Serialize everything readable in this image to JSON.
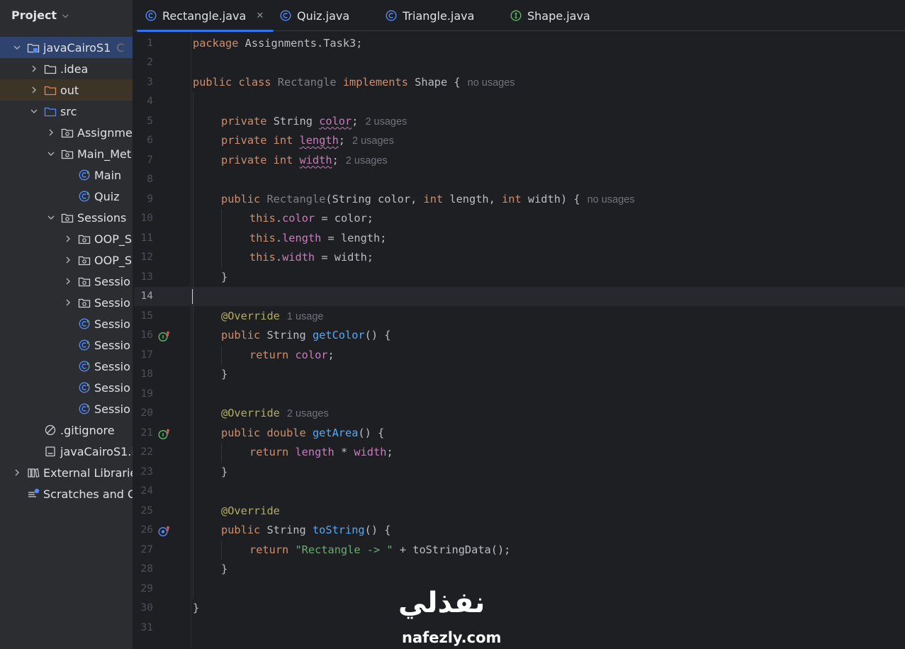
{
  "project_panel": {
    "title": "Project",
    "tree": [
      {
        "label": "javaCairoS1",
        "suffix": "C",
        "icon": "module-folder-icon",
        "depth": 0,
        "expanded": true,
        "selected": true
      },
      {
        "label": ".idea",
        "icon": "folder-icon",
        "depth": 1,
        "expanded": false
      },
      {
        "label": "out",
        "icon": "folder-excluded-icon",
        "depth": 1,
        "expanded": false,
        "excluded": true
      },
      {
        "label": "src",
        "icon": "source-folder-icon",
        "depth": 1,
        "expanded": true
      },
      {
        "label": "Assignme",
        "icon": "package-icon",
        "depth": 2,
        "expanded": false
      },
      {
        "label": "Main_Met",
        "icon": "package-icon",
        "depth": 2,
        "expanded": true
      },
      {
        "label": "Main",
        "icon": "java-class-icon",
        "depth": 3,
        "leaf": true
      },
      {
        "label": "Quiz",
        "icon": "java-class-icon",
        "depth": 3,
        "leaf": true
      },
      {
        "label": "Sessions",
        "icon": "package-icon",
        "depth": 2,
        "expanded": true
      },
      {
        "label": "OOP_S",
        "icon": "package-icon",
        "depth": 3,
        "expanded": false
      },
      {
        "label": "OOP_S",
        "icon": "package-icon",
        "depth": 3,
        "expanded": false
      },
      {
        "label": "Sessio",
        "icon": "package-icon",
        "depth": 3,
        "expanded": false
      },
      {
        "label": "Sessio",
        "icon": "package-icon",
        "depth": 3,
        "expanded": false
      },
      {
        "label": "Sessio",
        "icon": "java-class-icon",
        "depth": 3,
        "leaf": true
      },
      {
        "label": "Sessio",
        "icon": "java-class-icon",
        "depth": 3,
        "leaf": true
      },
      {
        "label": "Sessio",
        "icon": "java-class-icon",
        "depth": 3,
        "leaf": true
      },
      {
        "label": "Sessio",
        "icon": "java-class-icon",
        "depth": 3,
        "leaf": true
      },
      {
        "label": "Sessio",
        "icon": "java-class-icon",
        "depth": 3,
        "leaf": true
      },
      {
        "label": ".gitignore",
        "icon": "ignored-file-icon",
        "depth": 1,
        "leaf": true
      },
      {
        "label": "javaCairoS1.i",
        "icon": "iml-file-icon",
        "depth": 1,
        "leaf": true
      },
      {
        "label": "External Librarie",
        "icon": "libraries-icon",
        "depth": 0,
        "expanded": false
      },
      {
        "label": "Scratches and C",
        "icon": "scratches-icon",
        "depth": 0,
        "leaf": true
      }
    ]
  },
  "tabs": [
    {
      "label": "Rectangle.java",
      "icon": "class-icon",
      "active": true,
      "closable": true
    },
    {
      "label": "Quiz.java",
      "icon": "class-icon"
    },
    {
      "label": "Triangle.java",
      "icon": "class-icon"
    },
    {
      "label": "Shape.java",
      "icon": "interface-icon"
    }
  ],
  "editor": {
    "current_line": 14,
    "lines": [
      {
        "n": "1",
        "indent": 0,
        "t": [
          [
            "kw",
            "package"
          ],
          [
            "tx",
            " Assignments.Task3;"
          ]
        ]
      },
      {
        "n": "2",
        "indent": 0,
        "t": []
      },
      {
        "n": "3",
        "indent": 0,
        "t": [
          [
            "kw",
            "public class "
          ],
          [
            "cls-dim",
            "Rectangle "
          ],
          [
            "kw",
            "implements "
          ],
          [
            "tx",
            "Shape {"
          ],
          [
            "hint",
            "no usages"
          ]
        ]
      },
      {
        "n": "4",
        "indent": 0,
        "t": []
      },
      {
        "n": "5",
        "indent": 1,
        "t": [
          [
            "kw",
            "private "
          ],
          [
            "tx",
            "String "
          ],
          [
            "fld warn",
            "color"
          ],
          [
            "tx",
            ";"
          ],
          [
            "hint",
            "2 usages"
          ]
        ]
      },
      {
        "n": "6",
        "indent": 1,
        "t": [
          [
            "kw",
            "private int "
          ],
          [
            "fld warn",
            "length"
          ],
          [
            "tx",
            ";"
          ],
          [
            "hint",
            "2 usages"
          ]
        ]
      },
      {
        "n": "7",
        "indent": 1,
        "t": [
          [
            "kw",
            "private int "
          ],
          [
            "fld warn",
            "width"
          ],
          [
            "tx",
            ";"
          ],
          [
            "hint",
            "2 usages"
          ]
        ]
      },
      {
        "n": "8",
        "indent": 0,
        "t": []
      },
      {
        "n": "9",
        "indent": 1,
        "t": [
          [
            "kw",
            "public "
          ],
          [
            "cls-dim",
            "Rectangle"
          ],
          [
            "tx",
            "(String color, "
          ],
          [
            "kw",
            "int "
          ],
          [
            "tx",
            "length, "
          ],
          [
            "kw",
            "int "
          ],
          [
            "tx",
            "width) {"
          ],
          [
            "hint",
            "no usages"
          ]
        ]
      },
      {
        "n": "10",
        "indent": 2,
        "t": [
          [
            "kw",
            "this"
          ],
          [
            "tx",
            "."
          ],
          [
            "fld",
            "color"
          ],
          [
            "tx",
            " = color;"
          ]
        ]
      },
      {
        "n": "11",
        "indent": 2,
        "t": [
          [
            "kw",
            "this"
          ],
          [
            "tx",
            "."
          ],
          [
            "fld",
            "length"
          ],
          [
            "tx",
            " = length;"
          ]
        ]
      },
      {
        "n": "12",
        "indent": 2,
        "t": [
          [
            "kw",
            "this"
          ],
          [
            "tx",
            "."
          ],
          [
            "fld",
            "width"
          ],
          [
            "tx",
            " = width;"
          ]
        ]
      },
      {
        "n": "13",
        "indent": 1,
        "t": [
          [
            "tx",
            "}"
          ]
        ]
      },
      {
        "n": "14",
        "indent": 0,
        "t": []
      },
      {
        "n": "15",
        "indent": 1,
        "t": [
          [
            "ann",
            "@Override"
          ],
          [
            "hint",
            "1 usage"
          ]
        ]
      },
      {
        "n": "16",
        "indent": 1,
        "gutter": "implements-method-icon",
        "t": [
          [
            "kw",
            "public "
          ],
          [
            "tx",
            "String "
          ],
          [
            "fn",
            "getColor"
          ],
          [
            "tx",
            "() {"
          ]
        ]
      },
      {
        "n": "17",
        "indent": 2,
        "t": [
          [
            "kw",
            "return "
          ],
          [
            "fld",
            "color"
          ],
          [
            "tx",
            ";"
          ]
        ]
      },
      {
        "n": "18",
        "indent": 1,
        "t": [
          [
            "tx",
            "}"
          ]
        ]
      },
      {
        "n": "19",
        "indent": 0,
        "t": []
      },
      {
        "n": "20",
        "indent": 1,
        "t": [
          [
            "ann",
            "@Override"
          ],
          [
            "hint",
            "2 usages"
          ]
        ]
      },
      {
        "n": "21",
        "indent": 1,
        "gutter": "implements-method-icon",
        "t": [
          [
            "kw",
            "public double "
          ],
          [
            "fn",
            "getArea"
          ],
          [
            "tx",
            "() {"
          ]
        ]
      },
      {
        "n": "22",
        "indent": 2,
        "t": [
          [
            "kw",
            "return "
          ],
          [
            "fld",
            "length"
          ],
          [
            "tx",
            " * "
          ],
          [
            "fld",
            "width"
          ],
          [
            "tx",
            ";"
          ]
        ]
      },
      {
        "n": "23",
        "indent": 1,
        "t": [
          [
            "tx",
            "}"
          ]
        ]
      },
      {
        "n": "24",
        "indent": 0,
        "t": []
      },
      {
        "n": "25",
        "indent": 1,
        "t": [
          [
            "ann",
            "@Override"
          ]
        ]
      },
      {
        "n": "26",
        "indent": 1,
        "gutter": "overrides-method-icon",
        "t": [
          [
            "kw",
            "public "
          ],
          [
            "tx",
            "String "
          ],
          [
            "fn",
            "toString"
          ],
          [
            "tx",
            "() {"
          ]
        ]
      },
      {
        "n": "27",
        "indent": 2,
        "t": [
          [
            "kw",
            "return "
          ],
          [
            "str",
            "\"Rectangle -> \""
          ],
          [
            "tx",
            " + toStringData();"
          ]
        ]
      },
      {
        "n": "28",
        "indent": 1,
        "t": [
          [
            "tx",
            "}"
          ]
        ]
      },
      {
        "n": "29",
        "indent": 0,
        "t": []
      },
      {
        "n": "30",
        "indent": 0,
        "t": [
          [
            "tx",
            "}"
          ]
        ]
      },
      {
        "n": "31",
        "indent": 0,
        "t": []
      }
    ]
  },
  "watermark": {
    "arabic": "نفذلي",
    "latin": "nafezly.com"
  }
}
